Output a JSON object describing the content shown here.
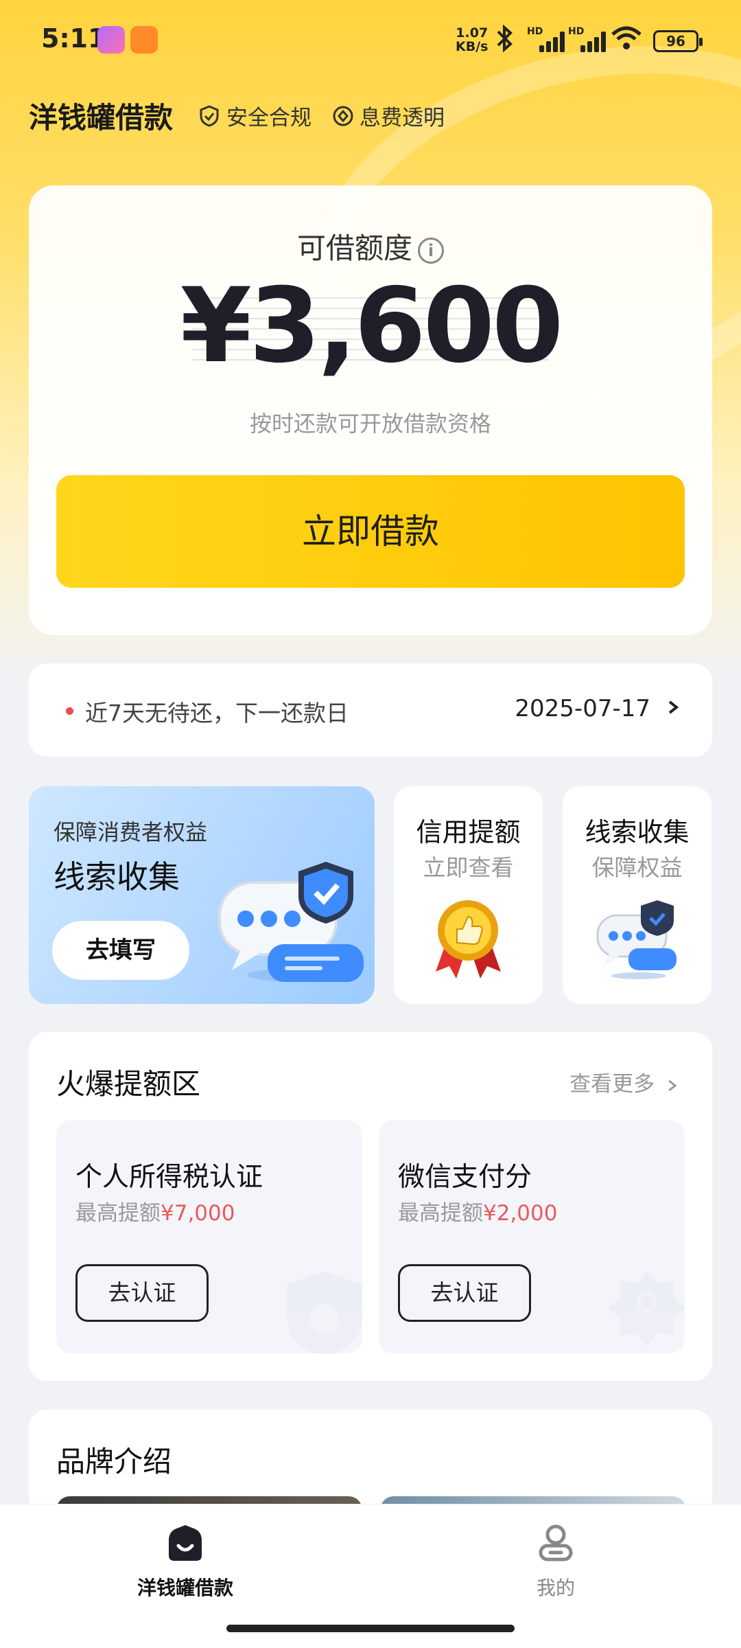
{
  "status_bar": {
    "time": "5:11",
    "net_speed_value": "1.07",
    "net_speed_unit": "KB/s",
    "battery": "96",
    "network_label": "HD"
  },
  "header": {
    "app_title": "洋钱罐借款",
    "badge_safe": "安全合规",
    "badge_fee": "息费透明"
  },
  "quota_card": {
    "label": "可借额度",
    "amount": "¥3,600",
    "subtitle": "按时还款可开放借款资格",
    "borrow_button": "立即借款"
  },
  "repay": {
    "text": "近7天无待还，下一还款日",
    "date": "2025-07-17"
  },
  "promo": {
    "big": {
      "subtitle": "保障消费者权益",
      "title": "线索收集",
      "button": "去填写"
    },
    "mini": [
      {
        "title": "信用提额",
        "subtitle": "立即查看"
      },
      {
        "title": "线索收集",
        "subtitle": "保障权益"
      }
    ]
  },
  "hot_area": {
    "title": "火爆提额区",
    "more": "查看更多",
    "cards": [
      {
        "title": "个人所得税认证",
        "prefix": "最高提额",
        "amount": "¥7,000",
        "button": "去认证"
      },
      {
        "title": "微信支付分",
        "prefix": "最高提额",
        "amount": "¥2,000",
        "button": "去认证"
      }
    ]
  },
  "brand_intro": {
    "title": "品牌介绍"
  },
  "tabbar": {
    "home": "洋钱罐借款",
    "mine": "我的"
  },
  "colors": {
    "accent_yellow": "#ffc400",
    "amount_red": "#e85a5a",
    "repay_dot": "#f04a4a"
  }
}
